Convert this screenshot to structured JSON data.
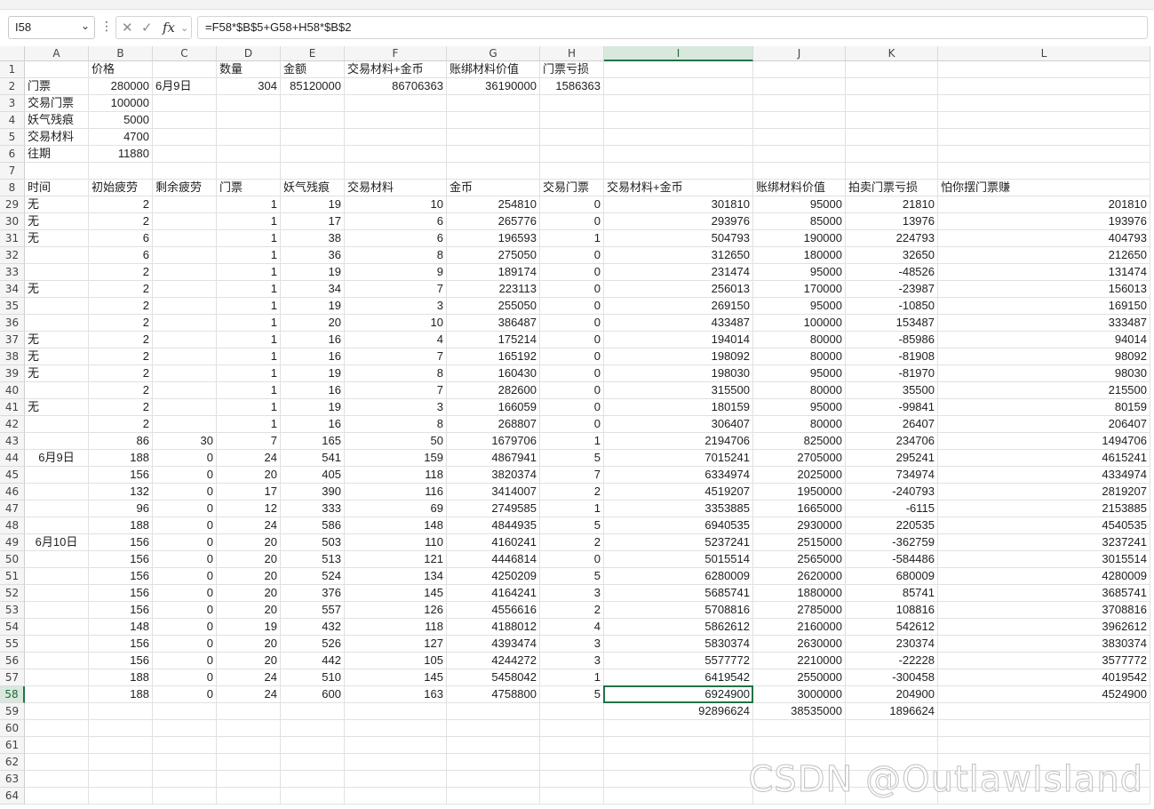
{
  "formula_bar": {
    "name_box": "I58",
    "cancel_icon": "✕",
    "confirm_icon": "✓",
    "fx_label": "fx",
    "formula": "=F58*$B$5+G58+H58*$B$2"
  },
  "icons": {
    "dropdown": "chevron-down-icon",
    "more": "kebab-icon",
    "cancel": "close-icon",
    "confirm": "check-icon",
    "function": "fx-icon"
  },
  "colors": {
    "accent": "#217346",
    "grid": "#e1e1e1",
    "header_bg": "#f5f5f5"
  },
  "columns": [
    "A",
    "B",
    "C",
    "D",
    "E",
    "F",
    "G",
    "H",
    "I",
    "J",
    "K",
    "L"
  ],
  "selected": {
    "col": "I",
    "row": "58"
  },
  "rows": [
    {
      "n": "1",
      "c": [
        "",
        "价格",
        "",
        "数量",
        "金额",
        "交易材料+金币",
        "账绑材料价值",
        "门票亏损",
        "",
        "",
        "",
        ""
      ]
    },
    {
      "n": "2",
      "c": [
        "门票",
        "280000",
        "6月9日",
        "304",
        "85120000",
        "86706363",
        "36190000",
        "1586363",
        "",
        "",
        "",
        ""
      ]
    },
    {
      "n": "3",
      "c": [
        "交易门票",
        "100000",
        "",
        "",
        "",
        "",
        "",
        "",
        "",
        "",
        "",
        ""
      ]
    },
    {
      "n": "4",
      "c": [
        "妖气残痕",
        "5000",
        "",
        "",
        "",
        "",
        "",
        "",
        "",
        "",
        "",
        ""
      ]
    },
    {
      "n": "5",
      "c": [
        "交易材料",
        "4700",
        "",
        "",
        "",
        "",
        "",
        "",
        "",
        "",
        "",
        ""
      ]
    },
    {
      "n": "6",
      "c": [
        "往期",
        "11880",
        "",
        "",
        "",
        "",
        "",
        "",
        "",
        "",
        "",
        ""
      ]
    },
    {
      "n": "7",
      "c": [
        "",
        "",
        "",
        "",
        "",
        "",
        "",
        "",
        "",
        "",
        "",
        ""
      ]
    },
    {
      "n": "8",
      "c": [
        "时间",
        "初始疲劳",
        "剩余疲劳",
        "门票",
        "妖气残痕",
        "交易材料",
        "金币",
        "交易门票",
        "交易材料+金币",
        "账绑材料价值",
        "拍卖门票亏损",
        "怕你摆门票赚"
      ]
    },
    {
      "n": "29",
      "c": [
        "无",
        "2",
        "",
        "1",
        "19",
        "10",
        "254810",
        "0",
        "301810",
        "95000",
        "21810",
        "201810"
      ]
    },
    {
      "n": "30",
      "c": [
        "无",
        "2",
        "",
        "1",
        "17",
        "6",
        "265776",
        "0",
        "293976",
        "85000",
        "13976",
        "193976"
      ]
    },
    {
      "n": "31",
      "c": [
        "无",
        "6",
        "",
        "1",
        "38",
        "6",
        "196593",
        "1",
        "504793",
        "190000",
        "224793",
        "404793"
      ]
    },
    {
      "n": "32",
      "c": [
        "",
        "6",
        "",
        "1",
        "36",
        "8",
        "275050",
        "0",
        "312650",
        "180000",
        "32650",
        "212650"
      ]
    },
    {
      "n": "33",
      "c": [
        "",
        "2",
        "",
        "1",
        "19",
        "9",
        "189174",
        "0",
        "231474",
        "95000",
        "-48526",
        "131474"
      ]
    },
    {
      "n": "34",
      "c": [
        "无",
        "2",
        "",
        "1",
        "34",
        "7",
        "223113",
        "0",
        "256013",
        "170000",
        "-23987",
        "156013"
      ]
    },
    {
      "n": "35",
      "c": [
        "",
        "2",
        "",
        "1",
        "19",
        "3",
        "255050",
        "0",
        "269150",
        "95000",
        "-10850",
        "169150"
      ]
    },
    {
      "n": "36",
      "c": [
        "",
        "2",
        "",
        "1",
        "20",
        "10",
        "386487",
        "0",
        "433487",
        "100000",
        "153487",
        "333487"
      ]
    },
    {
      "n": "37",
      "c": [
        "无",
        "2",
        "",
        "1",
        "16",
        "4",
        "175214",
        "0",
        "194014",
        "80000",
        "-85986",
        "94014"
      ]
    },
    {
      "n": "38",
      "c": [
        "无",
        "2",
        "",
        "1",
        "16",
        "7",
        "165192",
        "0",
        "198092",
        "80000",
        "-81908",
        "98092"
      ]
    },
    {
      "n": "39",
      "c": [
        "无",
        "2",
        "",
        "1",
        "19",
        "8",
        "160430",
        "0",
        "198030",
        "95000",
        "-81970",
        "98030"
      ]
    },
    {
      "n": "40",
      "c": [
        "",
        "2",
        "",
        "1",
        "16",
        "7",
        "282600",
        "0",
        "315500",
        "80000",
        "35500",
        "215500"
      ]
    },
    {
      "n": "41",
      "c": [
        "无",
        "2",
        "",
        "1",
        "19",
        "3",
        "166059",
        "0",
        "180159",
        "95000",
        "-99841",
        "80159"
      ]
    },
    {
      "n": "42",
      "c": [
        "",
        "2",
        "",
        "1",
        "16",
        "8",
        "268807",
        "0",
        "306407",
        "80000",
        "26407",
        "206407"
      ]
    },
    {
      "n": "43",
      "c": [
        "",
        "86",
        "30",
        "7",
        "165",
        "50",
        "1679706",
        "1",
        "2194706",
        "825000",
        "234706",
        "1494706"
      ]
    },
    {
      "n": "44",
      "c": [
        "6月9日",
        "188",
        "0",
        "24",
        "541",
        "159",
        "4867941",
        "5",
        "7015241",
        "2705000",
        "295241",
        "4615241"
      ]
    },
    {
      "n": "45",
      "c": [
        "",
        "156",
        "0",
        "20",
        "405",
        "118",
        "3820374",
        "7",
        "6334974",
        "2025000",
        "734974",
        "4334974"
      ]
    },
    {
      "n": "46",
      "c": [
        "",
        "132",
        "0",
        "17",
        "390",
        "116",
        "3414007",
        "2",
        "4519207",
        "1950000",
        "-240793",
        "2819207"
      ]
    },
    {
      "n": "47",
      "c": [
        "",
        "96",
        "0",
        "12",
        "333",
        "69",
        "2749585",
        "1",
        "3353885",
        "1665000",
        "-6115",
        "2153885"
      ]
    },
    {
      "n": "48",
      "c": [
        "",
        "188",
        "0",
        "24",
        "586",
        "148",
        "4844935",
        "5",
        "6940535",
        "2930000",
        "220535",
        "4540535"
      ]
    },
    {
      "n": "49",
      "c": [
        "6月10日",
        "156",
        "0",
        "20",
        "503",
        "110",
        "4160241",
        "2",
        "5237241",
        "2515000",
        "-362759",
        "3237241"
      ]
    },
    {
      "n": "50",
      "c": [
        "",
        "156",
        "0",
        "20",
        "513",
        "121",
        "4446814",
        "0",
        "5015514",
        "2565000",
        "-584486",
        "3015514"
      ]
    },
    {
      "n": "51",
      "c": [
        "",
        "156",
        "0",
        "20",
        "524",
        "134",
        "4250209",
        "5",
        "6280009",
        "2620000",
        "680009",
        "4280009"
      ]
    },
    {
      "n": "52",
      "c": [
        "",
        "156",
        "0",
        "20",
        "376",
        "145",
        "4164241",
        "3",
        "5685741",
        "1880000",
        "85741",
        "3685741"
      ]
    },
    {
      "n": "53",
      "c": [
        "",
        "156",
        "0",
        "20",
        "557",
        "126",
        "4556616",
        "2",
        "5708816",
        "2785000",
        "108816",
        "3708816"
      ]
    },
    {
      "n": "54",
      "c": [
        "",
        "148",
        "0",
        "19",
        "432",
        "118",
        "4188012",
        "4",
        "5862612",
        "2160000",
        "542612",
        "3962612"
      ]
    },
    {
      "n": "55",
      "c": [
        "",
        "156",
        "0",
        "20",
        "526",
        "127",
        "4393474",
        "3",
        "5830374",
        "2630000",
        "230374",
        "3830374"
      ]
    },
    {
      "n": "56",
      "c": [
        "",
        "156",
        "0",
        "20",
        "442",
        "105",
        "4244272",
        "3",
        "5577772",
        "2210000",
        "-22228",
        "3577772"
      ]
    },
    {
      "n": "57",
      "c": [
        "",
        "188",
        "0",
        "24",
        "510",
        "145",
        "5458042",
        "1",
        "6419542",
        "2550000",
        "-300458",
        "4019542"
      ]
    },
    {
      "n": "58",
      "c": [
        "",
        "188",
        "0",
        "24",
        "600",
        "163",
        "4758800",
        "5",
        "6924900",
        "3000000",
        "204900",
        "4524900"
      ]
    },
    {
      "n": "59",
      "c": [
        "",
        "",
        "",
        "",
        "",
        "",
        "",
        "",
        "92896624",
        "38535000",
        "1896624",
        ""
      ]
    },
    {
      "n": "60",
      "c": [
        "",
        "",
        "",
        "",
        "",
        "",
        "",
        "",
        "",
        "",
        "",
        ""
      ]
    },
    {
      "n": "61",
      "c": [
        "",
        "",
        "",
        "",
        "",
        "",
        "",
        "",
        "",
        "",
        "",
        ""
      ]
    },
    {
      "n": "62",
      "c": [
        "",
        "",
        "",
        "",
        "",
        "",
        "",
        "",
        "",
        "",
        "",
        ""
      ]
    },
    {
      "n": "63",
      "c": [
        "",
        "",
        "",
        "",
        "",
        "",
        "",
        "",
        "",
        "",
        "",
        ""
      ]
    },
    {
      "n": "64",
      "c": [
        "",
        "",
        "",
        "",
        "",
        "",
        "",
        "",
        "",
        "",
        "",
        ""
      ]
    }
  ],
  "watermark": "CSDN @OutlawIsland"
}
